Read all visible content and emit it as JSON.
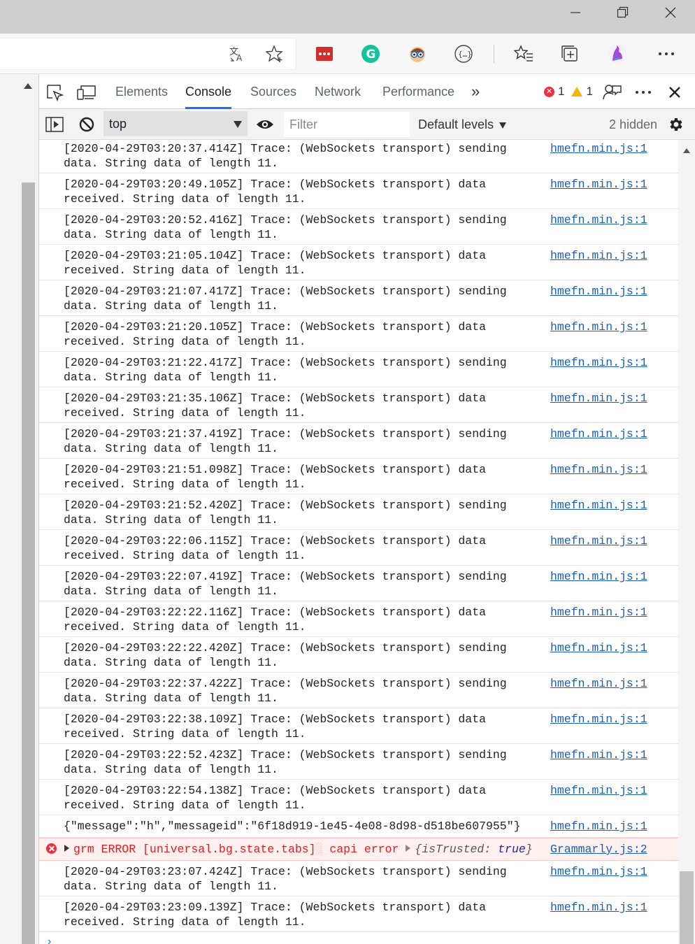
{
  "window": {
    "minimize_icon": "minimize-icon",
    "restore_icon": "restore-icon",
    "close_icon": "close-icon"
  },
  "browser": {
    "toolbar_icons": [
      "translate-icon",
      "favorite-star-icon",
      "lastpass-icon",
      "grammarly-icon",
      "extension-face-icon",
      "json-viewer-icon",
      "favorites-list-icon",
      "collections-icon",
      "profile-avatar-icon",
      "more-menu-icon"
    ]
  },
  "devtools": {
    "tabs": [
      "Elements",
      "Console",
      "Sources",
      "Network",
      "Performance"
    ],
    "active_tab": "Console",
    "more_tabs": "»",
    "errors_count": "1",
    "warnings_count": "1",
    "console": {
      "context": "top",
      "filter_placeholder": "Filter",
      "levels": "Default levels",
      "hidden": "2 hidden"
    }
  },
  "messages": [
    {
      "line1": "[2020-04-29T03:20:37.414Z] Trace: (WebSockets transport) sending",
      "line2": "data. String data of length 11.",
      "source": "hmefn.min.js:1"
    },
    {
      "line1": "[2020-04-29T03:20:49.105Z] Trace: (WebSockets transport) data",
      "line2": "received. String data of length 11.",
      "source": "hmefn.min.js:1"
    },
    {
      "line1": "[2020-04-29T03:20:52.416Z] Trace: (WebSockets transport) sending",
      "line2": "data. String data of length 11.",
      "source": "hmefn.min.js:1"
    },
    {
      "line1": "[2020-04-29T03:21:05.104Z] Trace: (WebSockets transport) data",
      "line2": "received. String data of length 11.",
      "source": "hmefn.min.js:1"
    },
    {
      "line1": "[2020-04-29T03:21:07.417Z] Trace: (WebSockets transport) sending",
      "line2": "data. String data of length 11.",
      "source": "hmefn.min.js:1"
    },
    {
      "line1": "[2020-04-29T03:21:20.105Z] Trace: (WebSockets transport) data",
      "line2": "received. String data of length 11.",
      "source": "hmefn.min.js:1"
    },
    {
      "line1": "[2020-04-29T03:21:22.417Z] Trace: (WebSockets transport) sending",
      "line2": "data. String data of length 11.",
      "source": "hmefn.min.js:1"
    },
    {
      "line1": "[2020-04-29T03:21:35.106Z] Trace: (WebSockets transport) data",
      "line2": "received. String data of length 11.",
      "source": "hmefn.min.js:1"
    },
    {
      "line1": "[2020-04-29T03:21:37.419Z] Trace: (WebSockets transport) sending",
      "line2": "data. String data of length 11.",
      "source": "hmefn.min.js:1"
    },
    {
      "line1": "[2020-04-29T03:21:51.098Z] Trace: (WebSockets transport) data",
      "line2": "received. String data of length 11.",
      "source": "hmefn.min.js:1"
    },
    {
      "line1": "[2020-04-29T03:21:52.420Z] Trace: (WebSockets transport) sending",
      "line2": "data. String data of length 11.",
      "source": "hmefn.min.js:1"
    },
    {
      "line1": "[2020-04-29T03:22:06.115Z] Trace: (WebSockets transport) data",
      "line2": "received. String data of length 11.",
      "source": "hmefn.min.js:1"
    },
    {
      "line1": "[2020-04-29T03:22:07.419Z] Trace: (WebSockets transport) sending",
      "line2": "data. String data of length 11.",
      "source": "hmefn.min.js:1"
    },
    {
      "line1": "[2020-04-29T03:22:22.116Z] Trace: (WebSockets transport) data",
      "line2": "received. String data of length 11.",
      "source": "hmefn.min.js:1"
    },
    {
      "line1": "[2020-04-29T03:22:22.420Z] Trace: (WebSockets transport) sending",
      "line2": "data. String data of length 11.",
      "source": "hmefn.min.js:1"
    },
    {
      "line1": "[2020-04-29T03:22:37.422Z] Trace: (WebSockets transport) sending",
      "line2": "data. String data of length 11.",
      "source": "hmefn.min.js:1"
    },
    {
      "line1": "[2020-04-29T03:22:38.109Z] Trace: (WebSockets transport) data",
      "line2": "received. String data of length 11.",
      "source": "hmefn.min.js:1"
    },
    {
      "line1": "[2020-04-29T03:22:52.423Z] Trace: (WebSockets transport) sending",
      "line2": "data. String data of length 11.",
      "source": "hmefn.min.js:1"
    },
    {
      "line1": "[2020-04-29T03:22:54.138Z] Trace: (WebSockets transport) data",
      "line2": "received. String data of length 11.",
      "source": "hmefn.min.js:1"
    }
  ],
  "json_message": {
    "text": "{\"message\":\"h\",\"messageid\":\"6f18d919-1e45-4e08-8d98-d518be607955\"}",
    "source": "hmefn.min.js:1"
  },
  "error_message": {
    "prefix": "grm ERROR [universal.bg.state.tabs]",
    "glyph": "░",
    "detail": " capi error ",
    "object_open": "{",
    "object_key": "isTrusted",
    "object_sep": ": ",
    "object_value": "true",
    "object_close": "}",
    "source": "Grammarly.js:2"
  },
  "messages_after": [
    {
      "line1": "[2020-04-29T03:23:07.424Z] Trace: (WebSockets transport) sending",
      "line2": "data. String data of length 11.",
      "source": "hmefn.min.js:1"
    },
    {
      "line1": "[2020-04-29T03:23:09.139Z] Trace: (WebSockets transport) data",
      "line2": "received. String data of length 11.",
      "source": "hmefn.min.js:1"
    }
  ],
  "prompt_symbol": "›",
  "colors": {
    "accent": "#1a73e8",
    "error": "#e31d1d",
    "link": "#1a5fb4"
  }
}
